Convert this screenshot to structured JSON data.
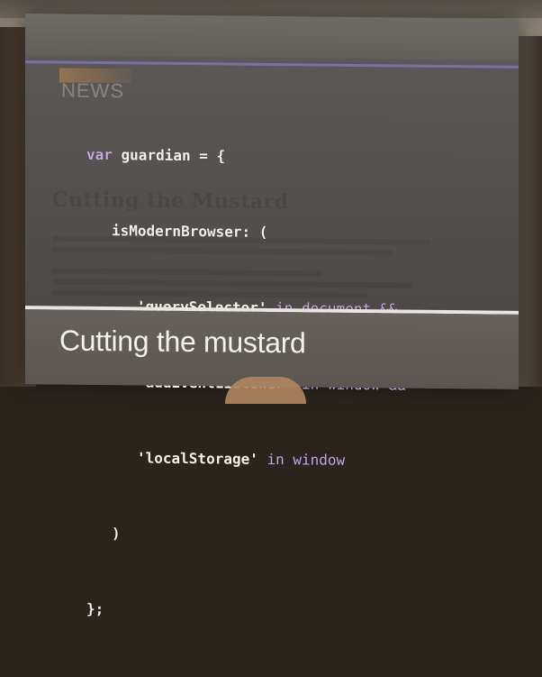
{
  "slide": {
    "brand": "NEWS",
    "ghost_heading": "Cutting the Mustard",
    "title": "Cutting the mustard",
    "code": {
      "line1": {
        "kw": "var",
        "rest": " guardian = {"
      },
      "line2": {
        "text": "isModernBrowser: ("
      },
      "line3": {
        "str": "'querySelector'",
        "kw": " in document &&"
      },
      "line4": {
        "str": "'addEventListener'",
        "kw": " in window &&"
      },
      "line5": {
        "str": "'localStorage'",
        "kw": " in window"
      },
      "line6": {
        "text": ")"
      },
      "line7": {
        "text": "};"
      }
    }
  },
  "colors": {
    "keyword": "#c8a6e6",
    "code_text": "#f4f1ea",
    "accent_line": "#7d6fa8",
    "footer_rule": "#e9e6e2"
  }
}
